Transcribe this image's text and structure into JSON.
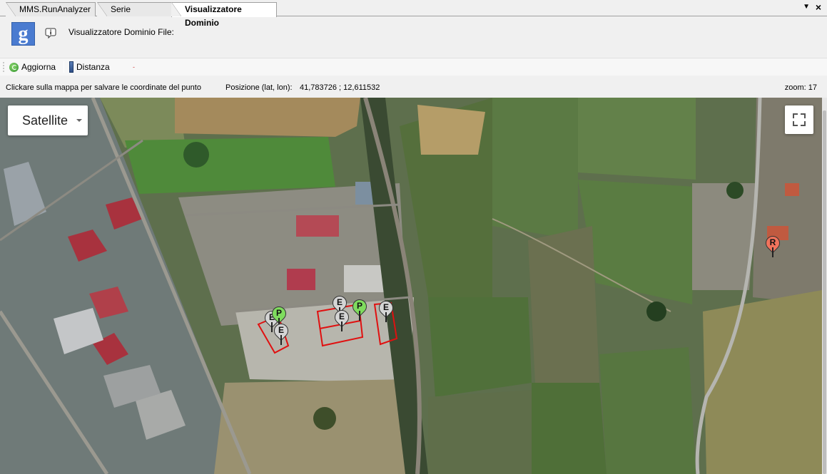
{
  "tabs": [
    {
      "label": "MMS.RunAnalyzer",
      "active": false
    },
    {
      "label": "Serie temporale",
      "active": false
    },
    {
      "label": "Visualizzatore Dominio",
      "active": true
    }
  ],
  "tab_controls": {
    "menu_icon": "chevron-down-icon",
    "close_icon": "close-icon",
    "menu_glyph": "▼",
    "close_glyph": "×"
  },
  "header": {
    "logo_letter": "g",
    "file_label": "Visualizzatore Dominio File:"
  },
  "toolbar": {
    "refresh_label": "Aggiorna",
    "distance_label": "Distanza",
    "marker": "-"
  },
  "status": {
    "hint": "Clickare sulla mappa per salvare le coordinate del punto",
    "position_label": "Posizione (lat, lon):",
    "position_value": "41,783726 ; 12,611532",
    "zoom": "zoom: 17"
  },
  "map": {
    "type_selector": "Satellite",
    "markers": [
      {
        "letter": "E",
        "color": "grey"
      },
      {
        "letter": "P",
        "color": "green"
      },
      {
        "letter": "E",
        "color": "grey"
      },
      {
        "letter": "E",
        "color": "grey"
      },
      {
        "letter": "E",
        "color": "grey"
      },
      {
        "letter": "P",
        "color": "green"
      },
      {
        "letter": "E",
        "color": "grey"
      },
      {
        "letter": "R",
        "color": "red"
      }
    ]
  },
  "colors": {
    "marker_grey": "#d5d5d5",
    "marker_green": "#7fdc5e",
    "marker_red": "#f0735c",
    "polygon_outline": "#e01010"
  }
}
